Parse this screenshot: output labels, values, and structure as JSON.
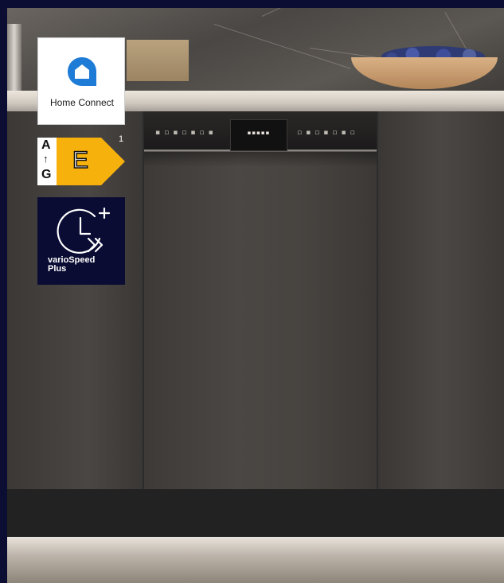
{
  "badges": {
    "home_connect": {
      "label": "Home Connect",
      "icon": "home-connect-icon"
    },
    "energy": {
      "scale_top": "A",
      "scale_bottom": "G",
      "class": "E",
      "footnote": "1",
      "class_color": "#f6b10c"
    },
    "vario_speed": {
      "line1": "varioSpeed",
      "line2": "Plus",
      "icon": "clock-forward-icon"
    }
  },
  "colors": {
    "frame": "#0b0d33",
    "home_connect_blue": "#1e7bd6"
  }
}
